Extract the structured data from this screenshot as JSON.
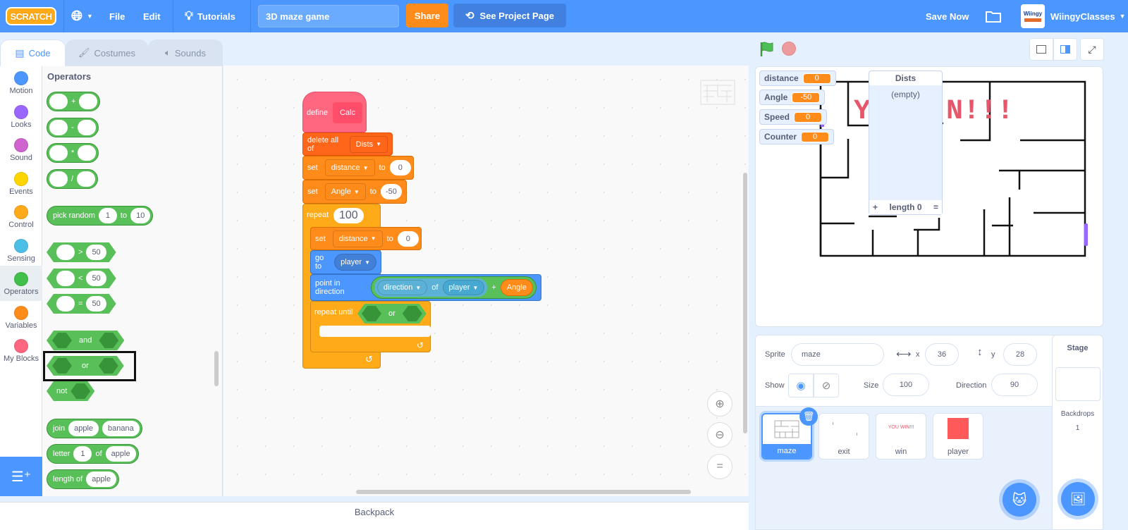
{
  "menubar": {
    "logo": "SCRATCH",
    "file": "File",
    "edit": "Edit",
    "tutorials": "Tutorials",
    "project_title": "3D maze game",
    "share": "Share",
    "see_project_page": "See Project Page",
    "save_now": "Save Now",
    "username": "WiingyClasses",
    "avatar_text": "Wiingy"
  },
  "tabs": [
    {
      "label": "Code",
      "active": true
    },
    {
      "label": "Costumes",
      "active": false
    },
    {
      "label": "Sounds",
      "active": false
    }
  ],
  "categories": [
    {
      "label": "Motion",
      "color": "#4c97ff"
    },
    {
      "label": "Looks",
      "color": "#9966ff"
    },
    {
      "label": "Sound",
      "color": "#cf63cf"
    },
    {
      "label": "Events",
      "color": "#ffd500"
    },
    {
      "label": "Control",
      "color": "#ffab19"
    },
    {
      "label": "Sensing",
      "color": "#4cbfe6"
    },
    {
      "label": "Operators",
      "color": "#40bf4a"
    },
    {
      "label": "Variables",
      "color": "#ff8c1a"
    },
    {
      "label": "My Blocks",
      "color": "#ff6680"
    }
  ],
  "palette": {
    "title": "Operators",
    "add": "+",
    "sub": "-",
    "mul": "*",
    "div": "/",
    "pick_random": "pick random",
    "pick_from": "1",
    "to": "to",
    "pick_to": "10",
    "gt": ">",
    "lt": "<",
    "eq": "=",
    "cmp_value": "50",
    "and": "and",
    "or": "or",
    "not": "not",
    "join": "join",
    "join_a": "apple",
    "join_b": "banana",
    "letter": "letter",
    "letter_idx": "1",
    "of": "of",
    "letter_str": "apple",
    "length_of": "length of",
    "length_str": "apple"
  },
  "script": {
    "define": "define",
    "proc_name": "Calc",
    "delete_all_of": "delete all of",
    "list_name": "Dists",
    "set": "set",
    "var_distance": "distance",
    "to": "to",
    "val_zero": "0",
    "var_angle": "Angle",
    "val_angle": "-50",
    "repeat": "repeat",
    "repeat_count": "100",
    "go_to": "go to",
    "target_player": "player",
    "point_in_direction": "point in direction",
    "direction": "direction",
    "of": "of",
    "plus": "+",
    "angle_reporter": "Angle",
    "repeat_until": "repeat until",
    "or": "or"
  },
  "workspace": {
    "zoom_in": "+",
    "zoom_out": "−",
    "zoom_reset": "="
  },
  "backpack": "Backpack",
  "stage": {
    "monitors": [
      {
        "label": "distance",
        "value": "0"
      },
      {
        "label": "Angle",
        "value": "-50"
      },
      {
        "label": "Speed",
        "value": "0"
      },
      {
        "label": "Counter",
        "value": "0"
      }
    ],
    "list": {
      "title": "Dists",
      "empty": "(empty)",
      "add": "+",
      "length": "length 0",
      "resize": "="
    },
    "win_text": "YOU WIN!!!"
  },
  "sprite_info": {
    "sprite_label": "Sprite",
    "sprite_name": "maze",
    "x_label": "x",
    "x": "36",
    "y_label": "y",
    "y": "28",
    "show_label": "Show",
    "size_label": "Size",
    "size": "100",
    "direction_label": "Direction",
    "direction": "90"
  },
  "sprites": [
    {
      "name": "maze",
      "selected": true
    },
    {
      "name": "exit",
      "selected": false
    },
    {
      "name": "win",
      "selected": false,
      "thumb_text": "YOU WIN!!!"
    },
    {
      "name": "player",
      "selected": false
    }
  ],
  "stage_pane": {
    "title": "Stage",
    "backdrops_label": "Backdrops",
    "backdrops_count": "1"
  },
  "colors": {
    "accent": "#4c97ff",
    "share": "#ff8c1a",
    "operators": "#59c059",
    "control": "#ffab19",
    "variables": "#ff8c1a",
    "myblocks": "#ff6680",
    "motion": "#4c97ff",
    "sensing": "#5cb1d6",
    "list": "#ff661a"
  }
}
